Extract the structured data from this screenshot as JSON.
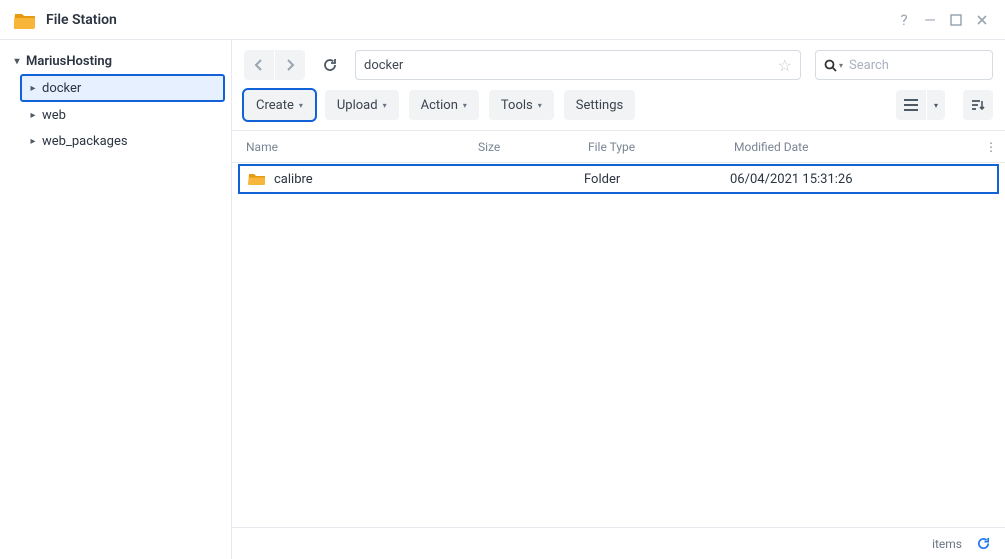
{
  "app": {
    "title": "File Station"
  },
  "window_controls": {
    "help": "?",
    "minimize": "—",
    "maximize": "▢",
    "close": "✕"
  },
  "sidebar": {
    "root": {
      "label": "MariusHosting",
      "expanded": true
    },
    "items": [
      {
        "label": "docker",
        "selected": true
      },
      {
        "label": "web",
        "selected": false
      },
      {
        "label": "web_packages",
        "selected": false
      }
    ]
  },
  "path": {
    "value": "docker"
  },
  "search": {
    "placeholder": "Search"
  },
  "toolbar": {
    "create": "Create",
    "upload": "Upload",
    "action": "Action",
    "tools": "Tools",
    "settings": "Settings"
  },
  "columns": {
    "name": "Name",
    "size": "Size",
    "type": "File Type",
    "date": "Modified Date"
  },
  "rows": [
    {
      "name": "calibre",
      "size": "",
      "type": "Folder",
      "date": "06/04/2021 15:31:26"
    }
  ],
  "status": {
    "items_label": "items"
  }
}
